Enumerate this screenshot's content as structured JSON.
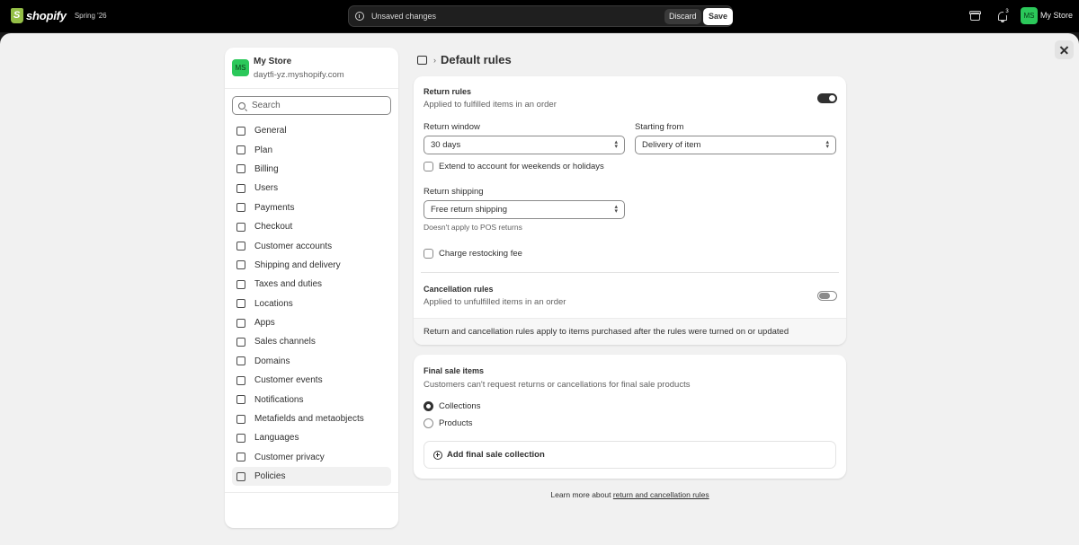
{
  "topbar": {
    "brand": "shopify",
    "badge": "Spring '26",
    "unsaved_label": "Unsaved changes",
    "discard_label": "Discard",
    "save_label": "Save",
    "notification_count": "3",
    "avatar_initials": "MS",
    "store_name": "My Store"
  },
  "sidebar": {
    "avatar_initials": "MS",
    "store_name": "My Store",
    "store_domain": "daytfi-yz.myshopify.com",
    "search_placeholder": "Search",
    "items": [
      {
        "label": "General",
        "icon": "store-icon"
      },
      {
        "label": "Plan",
        "icon": "plan-icon"
      },
      {
        "label": "Billing",
        "icon": "billing-icon"
      },
      {
        "label": "Users",
        "icon": "users-icon"
      },
      {
        "label": "Payments",
        "icon": "payments-icon"
      },
      {
        "label": "Checkout",
        "icon": "cart-icon"
      },
      {
        "label": "Customer accounts",
        "icon": "person-icon"
      },
      {
        "label": "Shipping and delivery",
        "icon": "truck-icon"
      },
      {
        "label": "Taxes and duties",
        "icon": "tax-icon"
      },
      {
        "label": "Locations",
        "icon": "location-icon"
      },
      {
        "label": "Apps",
        "icon": "apps-icon"
      },
      {
        "label": "Sales channels",
        "icon": "channels-icon"
      },
      {
        "label": "Domains",
        "icon": "globe-icon"
      },
      {
        "label": "Customer events",
        "icon": "events-icon"
      },
      {
        "label": "Notifications",
        "icon": "bell-icon"
      },
      {
        "label": "Metafields and metaobjects",
        "icon": "metafields-icon"
      },
      {
        "label": "Languages",
        "icon": "language-icon"
      },
      {
        "label": "Customer privacy",
        "icon": "lock-icon"
      },
      {
        "label": "Policies",
        "icon": "policy-icon",
        "active": true
      }
    ]
  },
  "page": {
    "title": "Default rules",
    "return_rules": {
      "title": "Return rules",
      "subtitle": "Applied to fulfilled items in an order",
      "enabled": true,
      "return_window_label": "Return window",
      "return_window_value": "30 days",
      "starting_from_label": "Starting from",
      "starting_from_value": "Delivery of item",
      "extend_label": "Extend to account for weekends or holidays",
      "return_shipping_label": "Return shipping",
      "return_shipping_value": "Free return shipping",
      "return_shipping_help": "Doesn't apply to POS returns",
      "restocking_label": "Charge restocking fee"
    },
    "cancellation_rules": {
      "title": "Cancellation rules",
      "subtitle": "Applied to unfulfilled items in an order",
      "enabled": false
    },
    "footer_note": "Return and cancellation rules apply to items purchased after the rules were turned on or updated",
    "final_sale": {
      "title": "Final sale items",
      "subtitle": "Customers can't request returns or cancellations for final sale products",
      "option_collections": "Collections",
      "option_products": "Products",
      "selected": "Collections",
      "add_label": "Add final sale collection"
    },
    "learn_more_prefix": "Learn more about ",
    "learn_more_link": "return and cancellation rules"
  }
}
